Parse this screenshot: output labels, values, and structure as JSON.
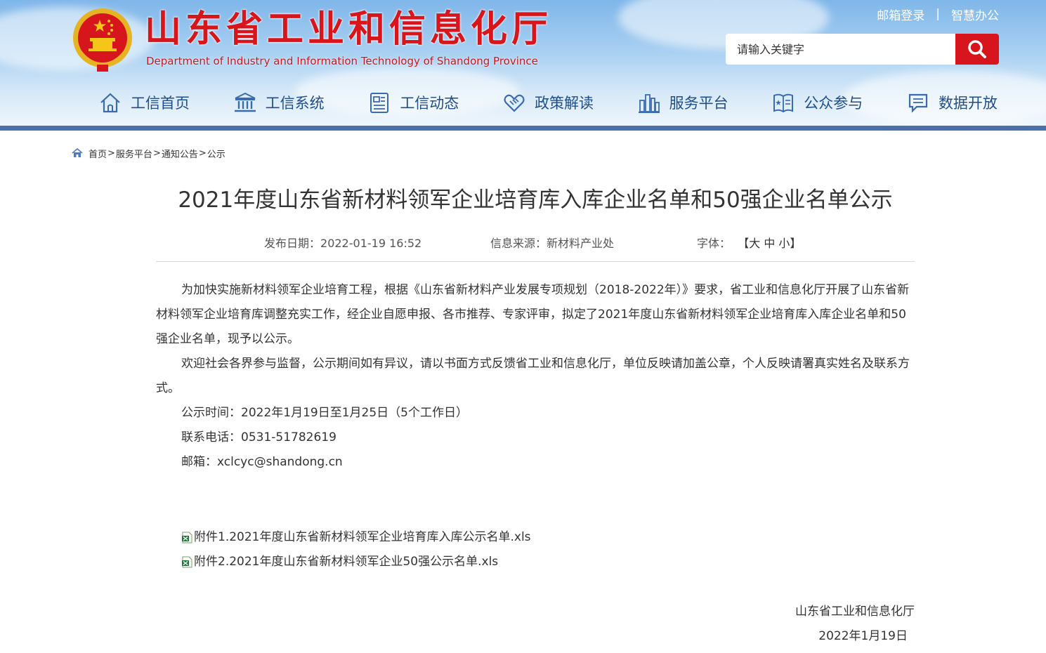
{
  "header": {
    "title_cn": "山东省工业和信息化厅",
    "title_en": "Department of Industry and Information Technology of Shandong Province",
    "top_links": {
      "mail_login": "邮箱登录",
      "separator": "|",
      "smart_office": "智慧办公"
    },
    "search": {
      "placeholder": "请输入关键字"
    },
    "nav": [
      {
        "label": "工信首页",
        "icon": "home-icon"
      },
      {
        "label": "工信系统",
        "icon": "building-icon"
      },
      {
        "label": "工信动态",
        "icon": "news-icon"
      },
      {
        "label": "政策解读",
        "icon": "handshake-icon"
      },
      {
        "label": "服务平台",
        "icon": "city-icon"
      },
      {
        "label": "公众参与",
        "icon": "book-icon"
      },
      {
        "label": "数据开放",
        "icon": "chat-icon"
      }
    ]
  },
  "breadcrumb": {
    "items": [
      "首页",
      "服务平台",
      "通知公告",
      "公示"
    ],
    "separator": ">"
  },
  "article": {
    "title": "2021年度山东省新材料领军企业培育库入库企业名单和50强企业名单公示",
    "meta": {
      "date_label": "发布日期：",
      "date": "2022-01-19 16:52",
      "source_label": "信息来源：",
      "source": "新材料产业处",
      "font_label": "字体：",
      "font_open": "【",
      "font_large": "大",
      "font_medium": "中",
      "font_small": "小",
      "font_close": "】"
    },
    "paragraphs": [
      "为加快实施新材料领军企业培育工程，根据《山东省新材料产业发展专项规划（2018-2022年）》要求，省工业和信息化厅开展了山东省新材料领军企业培育库调整充实工作，经企业自愿申报、各市推荐、专家评审，拟定了2021年度山东省新材料领军企业培育库入库企业名单和50强企业名单，现予以公示。",
      "欢迎社会各界参与监督，公示期间如有异议，请以书面方式反馈省工业和信息化厅，单位反映请加盖公章，个人反映请署真实姓名及联系方式。"
    ],
    "info_lines": [
      "公示时间：2022年1月19日至1月25日（5个工作日）",
      "联系电话：0531-51782619",
      "邮箱：xclcyc@shandong.cn"
    ],
    "attachments": [
      {
        "name": "附件1.2021年度山东省新材料领军企业培育库入库公示名单.xls",
        "icon": "excel-file-icon"
      },
      {
        "name": "附件2.2021年度山东省新材料领军企业50强公示名单.xls",
        "icon": "excel-file-icon"
      }
    ],
    "signature": {
      "org": "山东省工业和信息化厅",
      "date": "2022年1月19日"
    }
  },
  "colors": {
    "brand_red": "#d7151c",
    "nav_blue": "#1f4e8c",
    "header_line": "#4b6fa8"
  }
}
